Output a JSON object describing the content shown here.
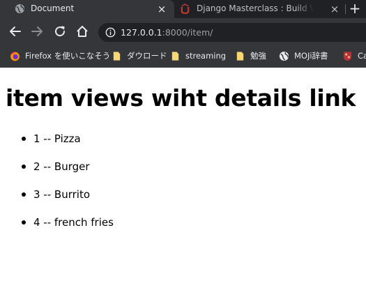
{
  "browser": {
    "tabs": [
      {
        "title": "Document",
        "active": true
      },
      {
        "title": "Django Masterclass : Build Web Apps",
        "active": false
      }
    ],
    "new_tab_label": "+",
    "close_label": "×",
    "address": {
      "host": "127.0.0.1",
      "rest": ":8000/item/"
    },
    "bookmarks": [
      {
        "label": "Firefox を使いこなそう",
        "icon": "firefox-icon"
      },
      {
        "label": "ダウロード",
        "icon": "folder-icon"
      },
      {
        "label": "streaming",
        "icon": "folder-icon"
      },
      {
        "label": "勉強",
        "icon": "folder-icon"
      },
      {
        "label": "MOJi辞書",
        "icon": "globe-icon"
      },
      {
        "label": "Ca",
        "icon": "university-icon"
      }
    ]
  },
  "page": {
    "heading": "item views wiht details link",
    "items": [
      {
        "id": "1",
        "name": "Pizza",
        "text": "1 -- Pizza"
      },
      {
        "id": "2",
        "name": "Burger",
        "text": "2 -- Burger"
      },
      {
        "id": "3",
        "name": "Burrito",
        "text": "3 -- Burrito"
      },
      {
        "id": "4",
        "name": "french fries",
        "text": "4 -- french fries"
      }
    ]
  },
  "colors": {
    "chrome_dark": "#202124",
    "chrome_toolbar": "#35363a",
    "chrome_text": "#e8eaed",
    "url_dim": "#9aa0a6",
    "folder_yellow": "#f8d775"
  }
}
